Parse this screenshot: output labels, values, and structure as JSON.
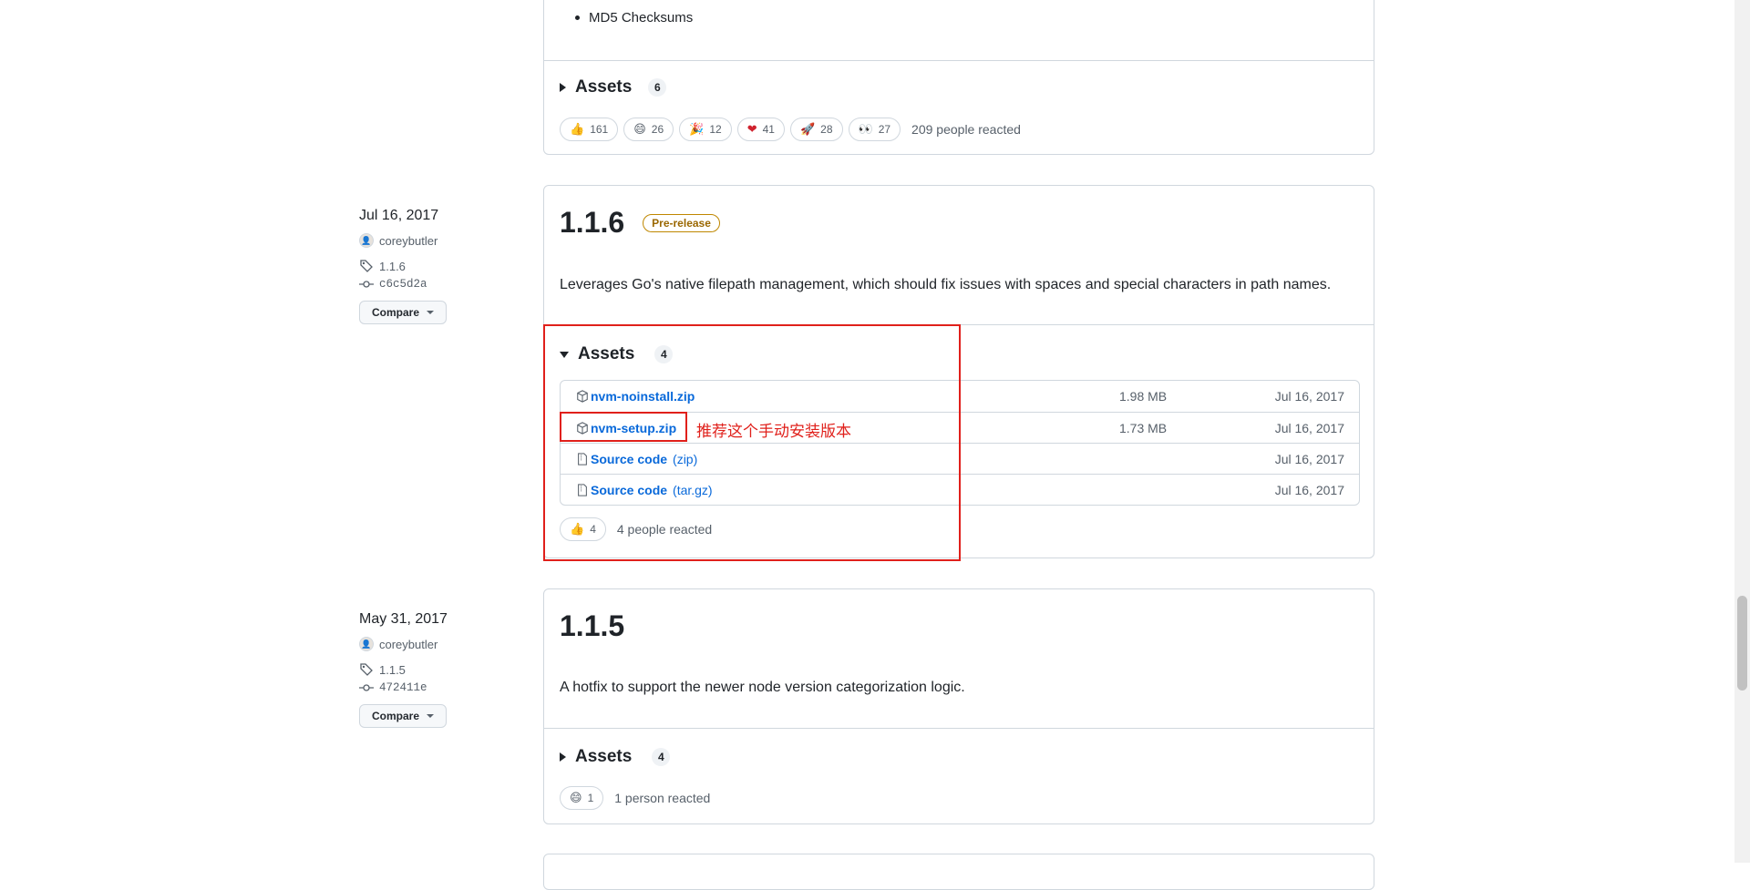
{
  "top_release": {
    "bullet_partial": "MD5 Checksums",
    "assets_label": "Assets",
    "assets_count": "6",
    "reactions": [
      {
        "icon": "thumbs-up-icon",
        "emoji": "👍",
        "count": "161"
      },
      {
        "icon": "laugh-icon",
        "emoji": "😄",
        "count": "26"
      },
      {
        "icon": "hooray-icon",
        "emoji": "🎉",
        "count": "12"
      },
      {
        "icon": "heart-icon",
        "emoji": "❤",
        "count": "41"
      },
      {
        "icon": "rocket-icon",
        "emoji": "🚀",
        "count": "28"
      },
      {
        "icon": "eyes-icon",
        "emoji": "👀",
        "count": "27"
      }
    ],
    "reacted_text": "209 people reacted"
  },
  "release_116": {
    "date": "Jul 16, 2017",
    "author": "coreybutler",
    "tag": "1.1.6",
    "commit": "c6c5d2a",
    "compare_label": "Compare",
    "title": "1.1.6",
    "badge": "Pre-release",
    "description": "Leverages Go's native filepath management, which should fix issues with spaces and special characters in path names.",
    "assets_label": "Assets",
    "assets_count": "4",
    "assets": [
      {
        "name": "nvm-noinstall.zip",
        "ext": "",
        "size": "1.98 MB",
        "date": "Jul 16, 2017",
        "icon": "package-icon"
      },
      {
        "name": "nvm-setup.zip",
        "ext": "",
        "size": "1.73 MB",
        "date": "Jul 16, 2017",
        "icon": "package-icon"
      },
      {
        "name": "Source code",
        "ext": "(zip)",
        "size": "",
        "date": "Jul 16, 2017",
        "icon": "file-zip-icon"
      },
      {
        "name": "Source code",
        "ext": "(tar.gz)",
        "size": "",
        "date": "Jul 16, 2017",
        "icon": "file-zip-icon"
      }
    ],
    "annotation": "推荐这个手动安装版本",
    "reactions": [
      {
        "icon": "thumbs-up-icon",
        "emoji": "👍",
        "count": "4"
      }
    ],
    "reacted_text": "4 people reacted"
  },
  "release_115": {
    "date": "May 31, 2017",
    "author": "coreybutler",
    "tag": "1.1.5",
    "commit": "472411e",
    "compare_label": "Compare",
    "title": "1.1.5",
    "description": "A hotfix to support the newer node version categorization logic.",
    "assets_label": "Assets",
    "assets_count": "4",
    "reactions": [
      {
        "icon": "laugh-icon",
        "emoji": "😄",
        "count": "1"
      }
    ],
    "reacted_text": "1 person reacted"
  },
  "colors": {
    "link": "#0969da",
    "border": "#d0d7de",
    "prerelease": "#9a6700",
    "annotation_red": "#e0201b"
  }
}
